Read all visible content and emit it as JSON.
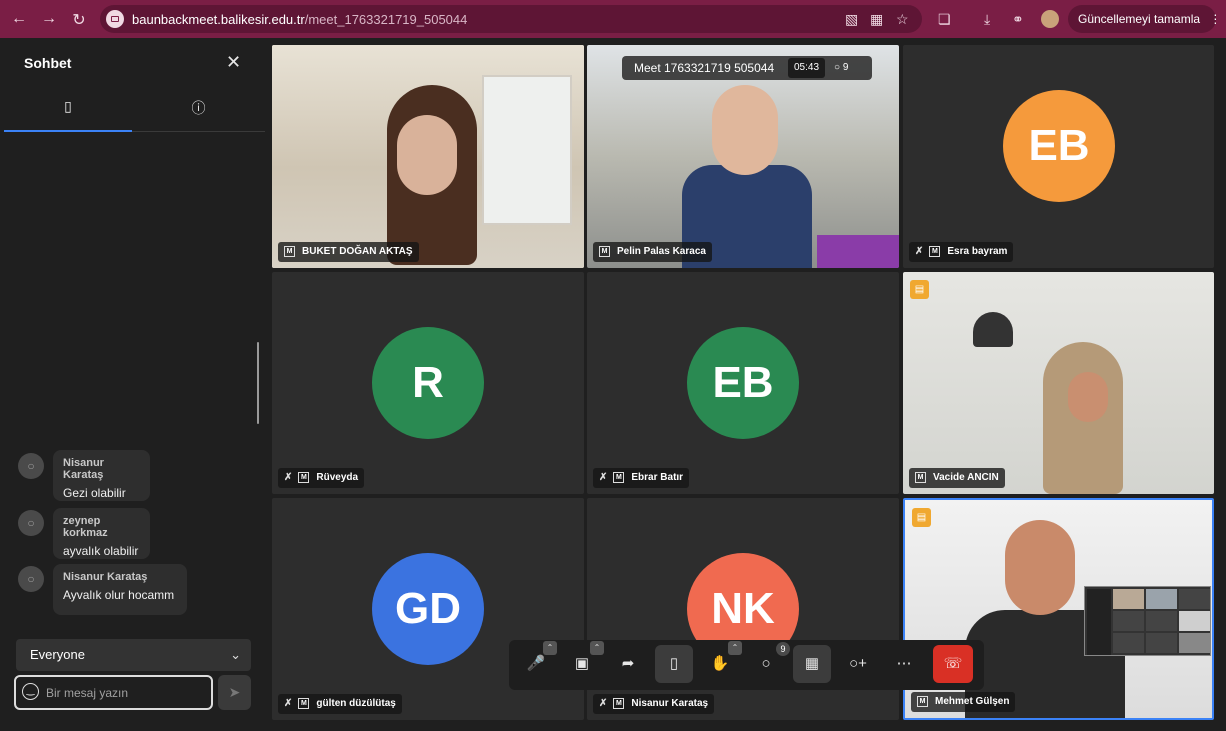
{
  "browser": {
    "domain": "baunbackmeet.balikesir.edu.tr",
    "path": "/meet_1763321719_505044",
    "update_label": "Güncellemeyi tamamla"
  },
  "chat": {
    "title": "Sohbet",
    "messages": [
      {
        "name": "Nisanur Karataş",
        "text": "Gezi olabilir"
      },
      {
        "name": "zeynep korkmaz",
        "text": "ayvalık olabilir"
      },
      {
        "name": "Nisanur Karataş",
        "text": "Ayvalık olur hocamm"
      }
    ],
    "recipient": "Everyone",
    "input_placeholder": "Bir mesaj yazın"
  },
  "meeting": {
    "name": "Meet 1763321719 505044",
    "elapsed": "05:43",
    "participant_count": "9"
  },
  "tiles": [
    {
      "name": "BUKET DOĞAN AKTAŞ",
      "type": "video"
    },
    {
      "name": "Pelin Palas Karaca",
      "type": "video"
    },
    {
      "name": "Esra bayram",
      "initials": "EB",
      "color": "#f59a3c",
      "muted": true
    },
    {
      "name": "Rüveyda",
      "initials": "R",
      "color": "#2a8a52",
      "muted": true
    },
    {
      "name": "Ebrar Batır",
      "initials": "EB",
      "color": "#2a8a52",
      "muted": true
    },
    {
      "name": "Vacide ANCIN",
      "type": "video"
    },
    {
      "name": "gülten düzülütaş",
      "initials": "GD",
      "color": "#3b73e0",
      "muted": true
    },
    {
      "name": "Nisanur Karataş",
      "initials": "NK",
      "color": "#f06a50",
      "muted": true
    },
    {
      "name": "Mehmet Gülşen",
      "type": "video"
    }
  ],
  "toolbar": {
    "participants_badge": "9"
  },
  "icons": {
    "badge_m": "M"
  }
}
